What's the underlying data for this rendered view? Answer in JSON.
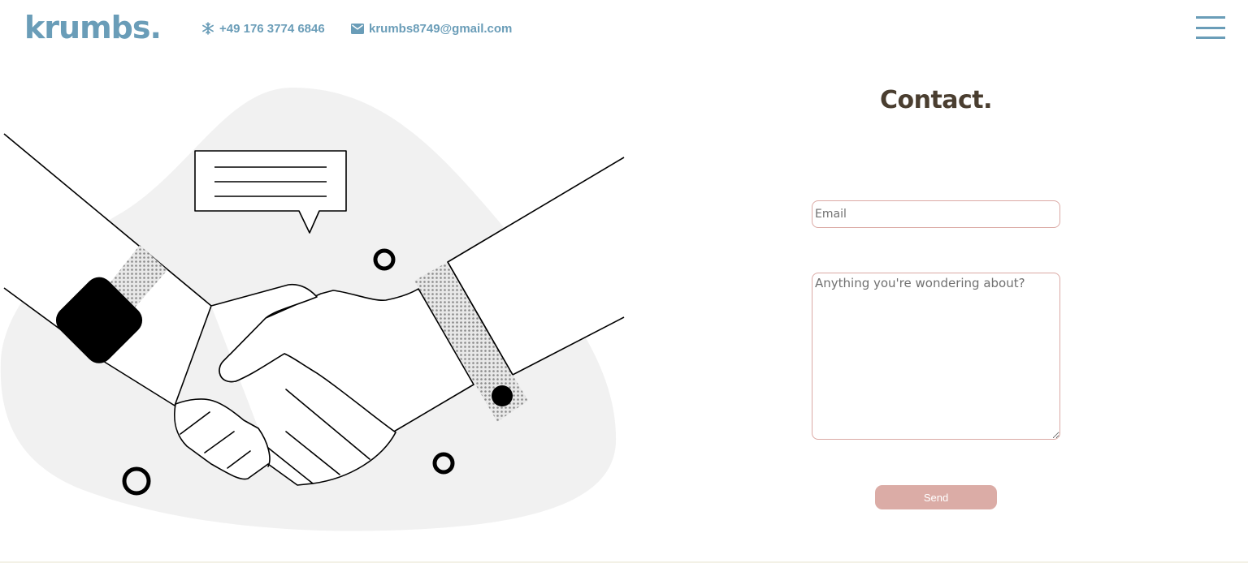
{
  "header": {
    "logo": "krumbs.",
    "phone": "+49 176 3774 6846",
    "email": "krumbs8749@gmail.com"
  },
  "contact_form": {
    "title": "Contact.",
    "email_placeholder": "Email",
    "message_placeholder": "Anything you're wondering about?",
    "send_label": "Send"
  },
  "colors": {
    "brand": "#6a9db8",
    "title": "#4a3e30",
    "accent": "#dbaca6",
    "field_border": "#dba9a4",
    "blob": "#f1f1f1"
  },
  "icons": {
    "phone": "snowflake-icon",
    "email": "mail-icon",
    "menu": "hamburger-menu-icon"
  }
}
